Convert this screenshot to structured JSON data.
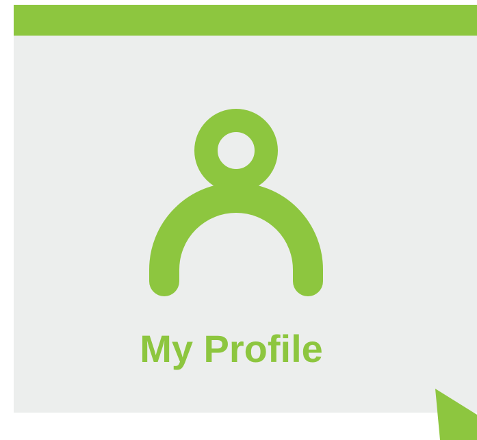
{
  "tile": {
    "title": "My Profile",
    "icon": "user-profile-icon",
    "colors": {
      "accent": "#8dc63f",
      "background": "#eceeed"
    }
  }
}
